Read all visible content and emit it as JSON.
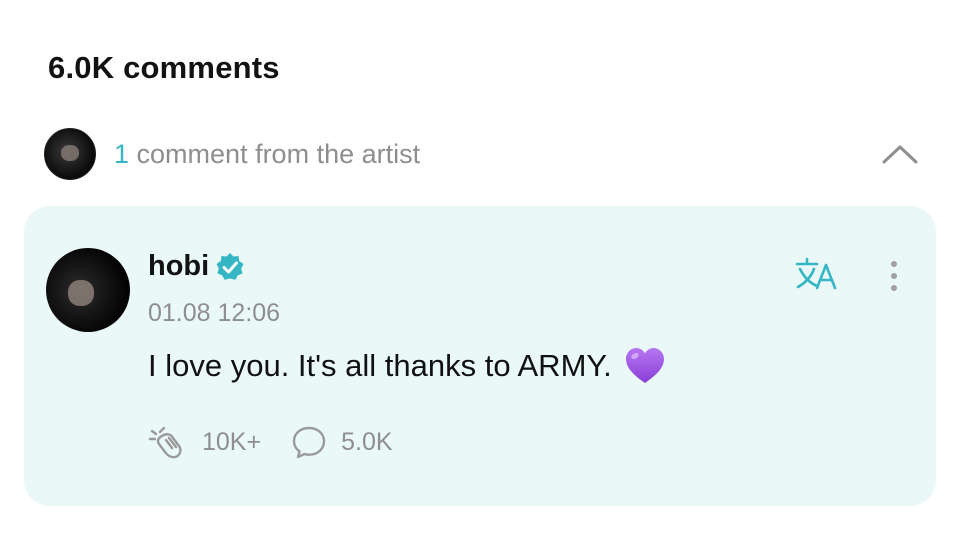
{
  "header": {
    "title": "6.0K comments"
  },
  "artist_summary": {
    "count": "1",
    "label": " comment from the artist",
    "toggle_icon": "chevron-up-icon"
  },
  "comment": {
    "username": "hobi",
    "verified_icon": "verified-badge-icon",
    "timestamp": "01.08 12:06",
    "text": "I love you. It's all thanks to ARMY.",
    "emoji": "purple-heart",
    "translate_icon": "translate-icon",
    "more_icon": "more-vertical-icon",
    "likes_count": "10K+",
    "replies_count": "5.0K"
  },
  "colors": {
    "accent": "#34b6c4",
    "card_bg": "#eaf9f8",
    "muted": "#8e8e8e",
    "heart": "#9b4be0"
  }
}
